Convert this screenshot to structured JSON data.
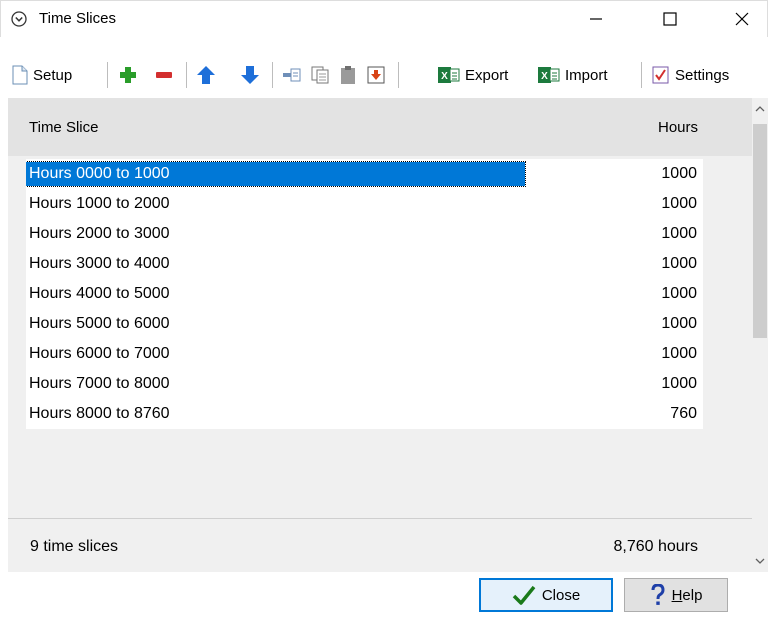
{
  "window": {
    "title": "Time Slices",
    "minimize_glyph": "—",
    "maximize_glyph": "☐",
    "close_glyph": "✕"
  },
  "toolbar": {
    "setup_label": "Setup",
    "export_label": "Export",
    "import_label": "Import",
    "settings_label": "Settings",
    "icons": [
      "document-icon",
      "add-icon",
      "remove-icon",
      "move-up-icon",
      "move-down-icon",
      "cut-icon",
      "copy-icon",
      "paste-icon",
      "paste-special-icon",
      "excel-icon",
      "settings-icon"
    ]
  },
  "grid": {
    "columns": [
      "Time Slice",
      "Hours"
    ],
    "rows": [
      {
        "name": "Hours 0000 to 1000",
        "hours": "1000"
      },
      {
        "name": "Hours 1000 to 2000",
        "hours": "1000"
      },
      {
        "name": "Hours 2000 to 3000",
        "hours": "1000"
      },
      {
        "name": "Hours 3000 to 4000",
        "hours": "1000"
      },
      {
        "name": "Hours 4000 to 5000",
        "hours": "1000"
      },
      {
        "name": "Hours 5000 to 6000",
        "hours": "1000"
      },
      {
        "name": "Hours 6000 to 7000",
        "hours": "1000"
      },
      {
        "name": "Hours 7000 to 8000",
        "hours": "1000"
      },
      {
        "name": "Hours 8000 to 8760",
        "hours": "760"
      }
    ],
    "selected_row": 0,
    "footer_count": "9 time slices",
    "footer_total": "8,760 hours"
  },
  "buttons": {
    "close_label": "Close",
    "help_prefix": "",
    "help_underline": "H",
    "help_rest": "elp"
  },
  "colors": {
    "selection": "#0078d7",
    "add_green": "#2a9d2a",
    "remove_red": "#d32f2f",
    "arrow_blue": "#1e6fd9",
    "excel_green": "#1d7a3e"
  }
}
